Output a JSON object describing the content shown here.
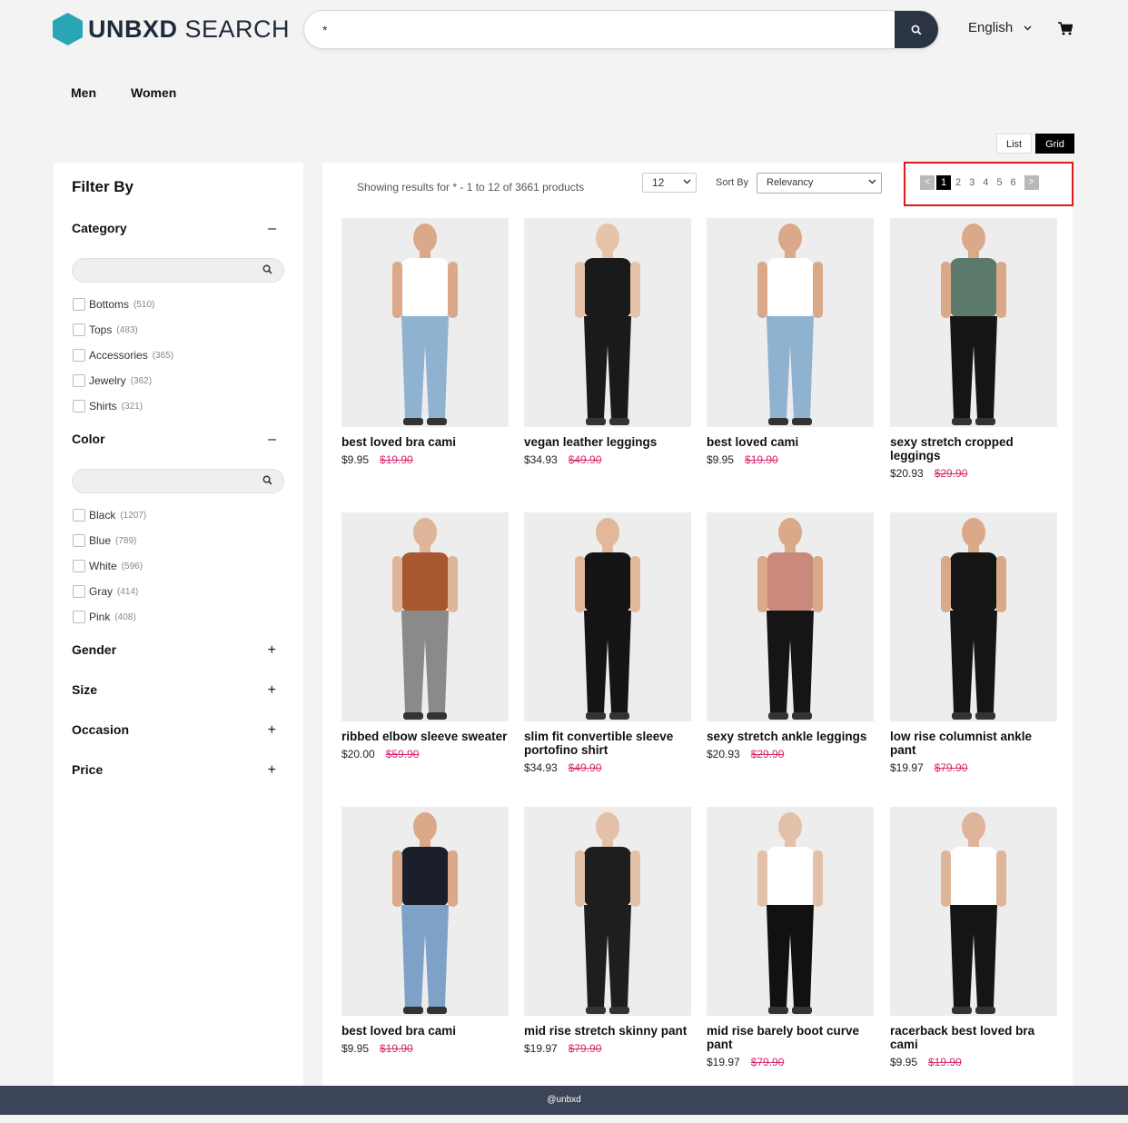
{
  "header": {
    "logo_bold": "UNBXD",
    "logo_light": "SEARCH",
    "search_value": "*",
    "language": "English"
  },
  "nav": [
    "Men",
    "Women"
  ],
  "view_toggle": {
    "list": "List",
    "grid": "Grid",
    "active": "Grid"
  },
  "sidebar": {
    "title": "Filter By",
    "facets": [
      {
        "name": "Category",
        "expanded": true,
        "sign": "–",
        "items": [
          {
            "label": "Bottoms",
            "count": "(510)"
          },
          {
            "label": "Tops",
            "count": "(483)"
          },
          {
            "label": "Accessories",
            "count": "(365)"
          },
          {
            "label": "Jewelry",
            "count": "(362)"
          },
          {
            "label": "Shirts",
            "count": "(321)"
          }
        ]
      },
      {
        "name": "Color",
        "expanded": true,
        "sign": "–",
        "items": [
          {
            "label": "Black",
            "count": "(1207)"
          },
          {
            "label": "Blue",
            "count": "(789)"
          },
          {
            "label": "White",
            "count": "(596)"
          },
          {
            "label": "Gray",
            "count": "(414)"
          },
          {
            "label": "Pink",
            "count": "(408)"
          }
        ]
      },
      {
        "name": "Gender",
        "expanded": false,
        "sign": "+"
      },
      {
        "name": "Size",
        "expanded": false,
        "sign": "+"
      },
      {
        "name": "Occasion",
        "expanded": false,
        "sign": "+"
      },
      {
        "name": "Price",
        "expanded": false,
        "sign": "+"
      }
    ]
  },
  "toolbar": {
    "results_text": "Showing results for * - 1 to 12 of 3661 products",
    "per_page": "12",
    "sort_label": "Sort By",
    "sort_value": "Relevancy"
  },
  "pagination": {
    "prev": "<",
    "next": ">",
    "pages": [
      "1",
      "2",
      "3",
      "4",
      "5",
      "6"
    ],
    "current": "1"
  },
  "products": [
    {
      "name": "best loved bra cami",
      "price": "$9.95",
      "old_price": "$19.90",
      "top": "#ffffff",
      "bottom": "#8fb2d0",
      "skin": "#d9a989"
    },
    {
      "name": "vegan leather leggings",
      "price": "$34.93",
      "old_price": "$49.90",
      "top": "#1a1a1a",
      "bottom": "#1a1a1a",
      "skin": "#e7c3a9"
    },
    {
      "name": "best loved cami",
      "price": "$9.95",
      "old_price": "$19.90",
      "top": "#ffffff",
      "bottom": "#8fb2d0",
      "skin": "#d9a989"
    },
    {
      "name": "sexy stretch cropped leggings",
      "price": "$20.93",
      "old_price": "$29.90",
      "top": "#5b7a6c",
      "bottom": "#151515",
      "skin": "#d9a989"
    },
    {
      "name": "ribbed elbow sleeve sweater",
      "price": "$20.00",
      "old_price": "$59.90",
      "top": "#a8582f",
      "bottom": "#8a8a8a",
      "skin": "#dfb59a"
    },
    {
      "name": "slim fit convertible sleeve portofino shirt",
      "price": "$34.93",
      "old_price": "$49.90",
      "top": "#141414",
      "bottom": "#141414",
      "skin": "#e2b79a"
    },
    {
      "name": "sexy stretch ankle leggings",
      "price": "$20.93",
      "old_price": "$29.90",
      "top": "#c98a7d",
      "bottom": "#151515",
      "skin": "#d9a989"
    },
    {
      "name": "low rise columnist ankle pant",
      "price": "$19.97",
      "old_price": "$79.90",
      "top": "#151515",
      "bottom": "#151515",
      "skin": "#d9a989"
    },
    {
      "name": "best loved bra cami",
      "price": "$9.95",
      "old_price": "$19.90",
      "top": "#1b1f2a",
      "bottom": "#7ea2c7",
      "skin": "#d9a989"
    },
    {
      "name": "mid rise stretch skinny pant",
      "price": "$19.97",
      "old_price": "$79.90",
      "top": "#1e1e1e",
      "bottom": "#1e1e1e",
      "skin": "#e2c1a8"
    },
    {
      "name": "mid rise barely boot curve pant",
      "price": "$19.97",
      "old_price": "$79.90",
      "top": "#ffffff",
      "bottom": "#111111",
      "skin": "#e2c1a8"
    },
    {
      "name": "racerback best loved bra cami",
      "price": "$9.95",
      "old_price": "$19.90",
      "top": "#ffffff",
      "bottom": "#151515",
      "skin": "#dfb59a"
    }
  ],
  "footer": "@unbxd"
}
